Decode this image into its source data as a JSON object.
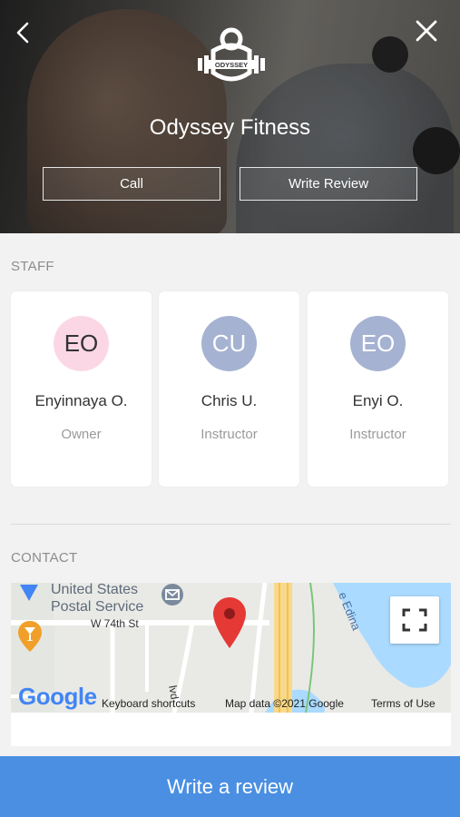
{
  "header": {
    "logo_text": "ODYSSEY",
    "gym_name": "Odyssey Fitness",
    "call_label": "Call",
    "write_review_label": "Write Review"
  },
  "staff": {
    "title": "STAFF",
    "members": [
      {
        "initials": "EO",
        "name": "Enyinnaya O.",
        "role": "Owner",
        "avatar_bg": "#fbd7e6"
      },
      {
        "initials": "CU",
        "name": "Chris U.",
        "role": "Instructor",
        "avatar_bg": "#a5b2d2"
      },
      {
        "initials": "EO",
        "name": "Enyi O.",
        "role": "Instructor",
        "avatar_bg": "#a5b2d2"
      }
    ]
  },
  "contact": {
    "title": "CONTACT",
    "map": {
      "poi_name": "United States Postal Service",
      "street": "W 74th St",
      "lake_label": "e Edina",
      "road_partial": "lvd",
      "google": "Google",
      "keyboard_shortcuts": "Keyboard shortcuts",
      "map_data": "Map data ©2021 Google",
      "terms": "Terms of Use"
    }
  },
  "cta": {
    "label": "Write a review",
    "color": "#4a8fe2"
  },
  "icons": {
    "back": "chevron-left-icon",
    "close": "close-icon",
    "fullscreen": "fullscreen-icon",
    "map_pin": "map-pin-icon"
  }
}
